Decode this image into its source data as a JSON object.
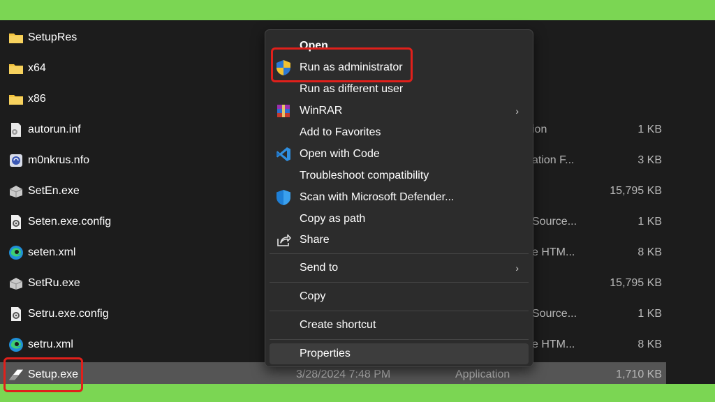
{
  "files": [
    {
      "name": "SetupRes",
      "icon": "folder-icon",
      "date": "",
      "type": "",
      "size": ""
    },
    {
      "name": "x64",
      "icon": "folder-icon",
      "date": "",
      "type": "",
      "size": ""
    },
    {
      "name": "x86",
      "icon": "folder-icon",
      "date": "",
      "type": "",
      "size": ""
    },
    {
      "name": "autorun.inf",
      "icon": "inf-file-icon",
      "date": "",
      "type": "ion",
      "size": "1 KB"
    },
    {
      "name": "m0nkrus.nfo",
      "icon": "nfo-file-icon",
      "date": "",
      "type": "ation F...",
      "size": "3 KB"
    },
    {
      "name": "SetEn.exe",
      "icon": "installer-icon",
      "date": "",
      "type": "",
      "size": "15,795 KB"
    },
    {
      "name": "Seten.exe.config",
      "icon": "config-file-icon",
      "date": "",
      "type": "Source...",
      "size": "1 KB"
    },
    {
      "name": "seten.xml",
      "icon": "edge-icon",
      "date": "",
      "type": "e HTM...",
      "size": "8 KB"
    },
    {
      "name": "SetRu.exe",
      "icon": "installer-icon",
      "date": "",
      "type": "",
      "size": "15,795 KB"
    },
    {
      "name": "Setru.exe.config",
      "icon": "config-file-icon",
      "date": "",
      "type": "Source...",
      "size": "1 KB"
    },
    {
      "name": "setru.xml",
      "icon": "edge-icon",
      "date": "",
      "type": "e HTM...",
      "size": "8 KB"
    },
    {
      "name": "Setup.exe",
      "icon": "autodesk-icon",
      "date": "3/28/2024 7:48 PM",
      "type": "Application",
      "size": "1,710 KB"
    }
  ],
  "menu": {
    "open": "Open",
    "run_as_admin": "Run as administrator",
    "run_as_different_user": "Run as different user",
    "winrar": "WinRAR",
    "add_to_favorites": "Add to Favorites",
    "open_with_code": "Open with Code",
    "troubleshoot": "Troubleshoot compatibility",
    "scan_defender": "Scan with Microsoft Defender...",
    "copy_as_path": "Copy as path",
    "share": "Share",
    "send_to": "Send to",
    "copy": "Copy",
    "create_shortcut": "Create shortcut",
    "properties": "Properties",
    "submenu_arrow": "›"
  },
  "colors": {
    "frame": "#7bd653",
    "explorer_bg": "#1c1c1c",
    "selected_row": "#555555",
    "menu_bg": "#2c2c2c",
    "highlight": "#e0201b",
    "folder": "#f3c33d"
  }
}
